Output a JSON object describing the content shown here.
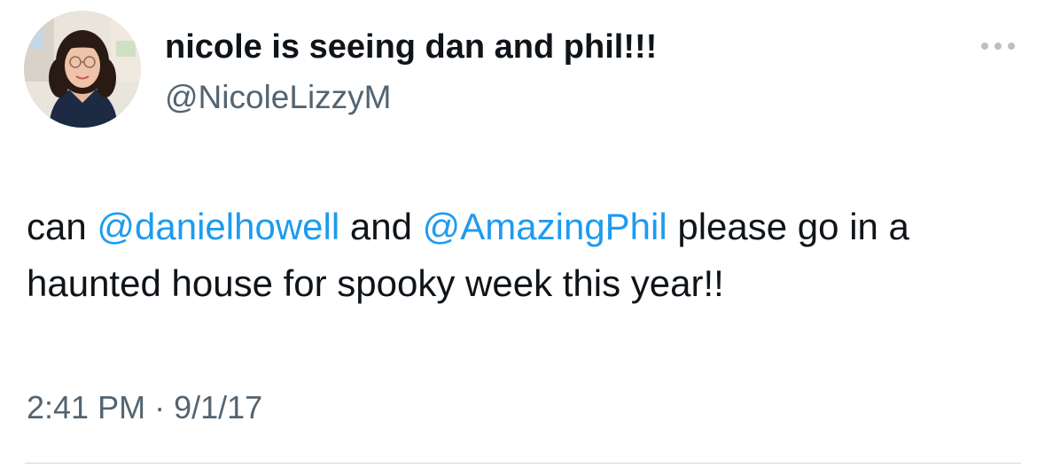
{
  "author": {
    "display_name": "nicole is seeing dan and phil!!!",
    "handle": "@NicoleLizzyM",
    "avatar_icon": "profile-photo"
  },
  "more_icon": "more-horizontal-icon",
  "tweet": {
    "text_parts": [
      {
        "text": "can ",
        "type": "text"
      },
      {
        "text": "@danielhowell",
        "type": "mention"
      },
      {
        "text": " and ",
        "type": "text"
      },
      {
        "text": "@AmazingPhil",
        "type": "mention"
      },
      {
        "text": " please go in a haunted house for spooky week this year!!",
        "type": "text"
      }
    ]
  },
  "meta": {
    "time": "2:41 PM",
    "separator": "·",
    "date": "9/1/17"
  },
  "colors": {
    "text_primary": "#0f1419",
    "text_secondary": "#536471",
    "link": "#1d9bf0",
    "divider": "#cfd9de"
  }
}
